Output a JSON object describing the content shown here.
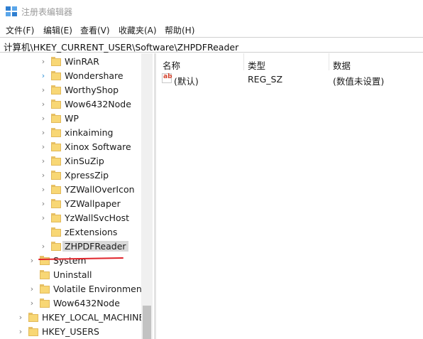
{
  "window": {
    "title": "注册表编辑器",
    "icon": "registry-editor-icon"
  },
  "menu": {
    "file": "文件(F)",
    "edit": "编辑(E)",
    "view": "查看(V)",
    "favorites": "收藏夹(A)",
    "help": "帮助(H)"
  },
  "address": {
    "path": "计算机\\HKEY_CURRENT_USER\\Software\\ZHPDFReader"
  },
  "tree": {
    "items": [
      {
        "label": "WinRAR",
        "expander": "chevron-right"
      },
      {
        "label": "Wondershare",
        "expander": "chevron-right-blue"
      },
      {
        "label": "WorthyShop",
        "expander": "chevron-right"
      },
      {
        "label": "Wow6432Node",
        "expander": "chevron-right"
      },
      {
        "label": "WP",
        "expander": "chevron-right"
      },
      {
        "label": "xinkaiming",
        "expander": "chevron-right"
      },
      {
        "label": "Xinox Software",
        "expander": "chevron-right"
      },
      {
        "label": "XinSuZip",
        "expander": "chevron-right"
      },
      {
        "label": "XpressZip",
        "expander": "chevron-right"
      },
      {
        "label": "YZWallOverIcon",
        "expander": "chevron-right"
      },
      {
        "label": "YZWallpaper",
        "expander": "chevron-right"
      },
      {
        "label": "YzWallSvcHost",
        "expander": "chevron-right"
      },
      {
        "label": "zExtensions",
        "expander": "none"
      },
      {
        "label": "ZHPDFReader",
        "expander": "chevron-right",
        "selected": true
      },
      {
        "label": "System",
        "expander": "chevron-right"
      },
      {
        "label": "Uninstall",
        "expander": "none"
      },
      {
        "label": "Volatile Environment",
        "expander": "chevron-right"
      },
      {
        "label": "Wow6432Node",
        "expander": "chevron-right"
      },
      {
        "label": "HKEY_LOCAL_MACHINE",
        "expander": "chevron-right"
      },
      {
        "label": "HKEY_USERS",
        "expander": "chevron-right"
      }
    ]
  },
  "list": {
    "columns": [
      "名称",
      "类型",
      "数据"
    ],
    "rows": [
      {
        "name": "(默认)",
        "type": "REG_SZ",
        "data": "(数值未设置)",
        "icon": "string-value-icon"
      }
    ]
  },
  "colors": {
    "folder": "#f8d775",
    "selection": "#d9d9d9",
    "annotation": "#e0242b",
    "expander_active": "#2c8fd6"
  }
}
